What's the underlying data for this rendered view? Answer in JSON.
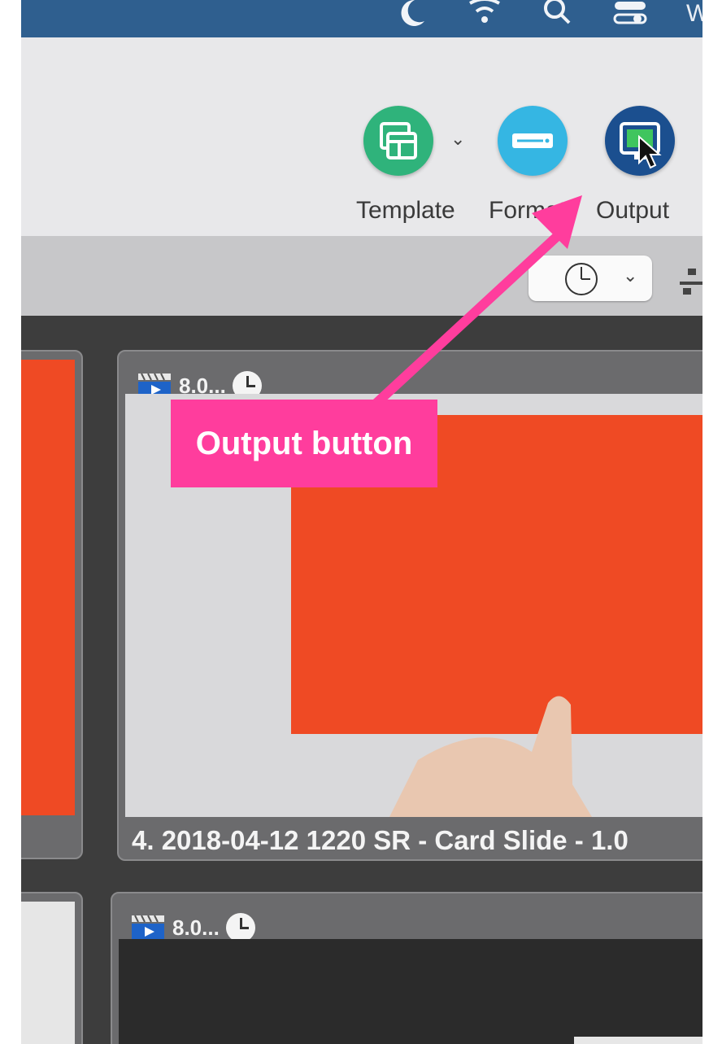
{
  "toolbar": {
    "template_label": "Template",
    "format_label": "Format",
    "output_label": "Output",
    "colors": {
      "template": "#2fb37b",
      "format": "#35b6e3",
      "output": "#1b4f8f"
    }
  },
  "menubar_icons": [
    "moon-icon",
    "wifi-icon",
    "search-icon",
    "control-center-icon"
  ],
  "annotation": {
    "label": "Output button",
    "color": "#ff3d9d"
  },
  "clips": [
    {
      "duration": "8.0...",
      "caption": "4. 2018-04-12 1220 SR - Card Slide - 1.0"
    },
    {
      "duration": "8.0..."
    }
  ]
}
